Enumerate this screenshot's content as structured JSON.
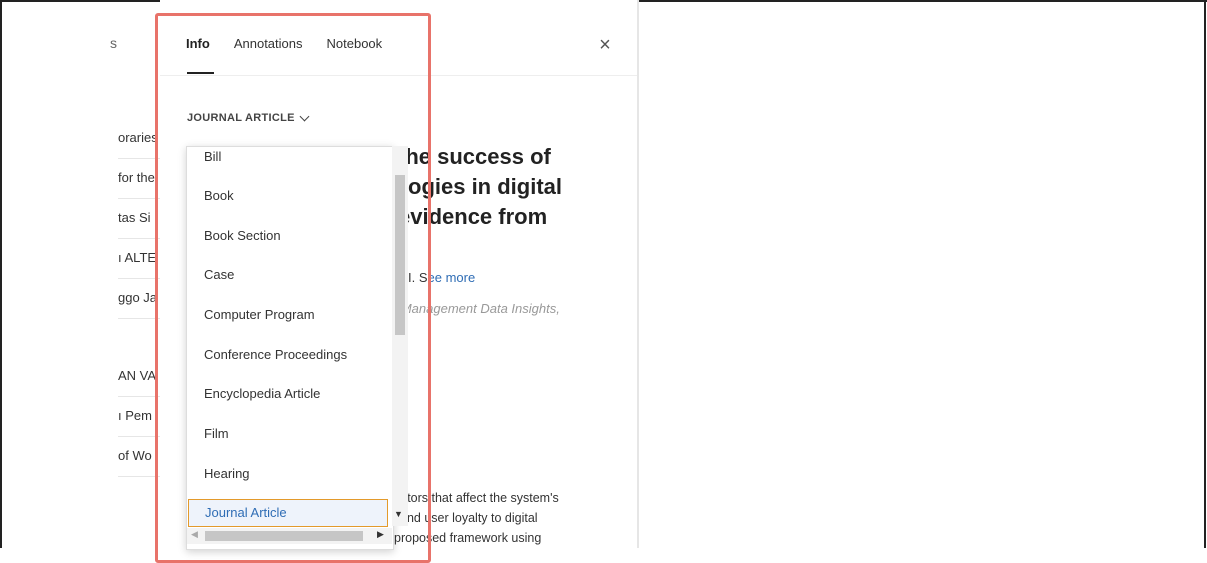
{
  "left_list": {
    "tab_fragment": "s",
    "items": [
      "oraries",
      "for the",
      "tas Si",
      "ı ALTE",
      "ggo Ja",
      "AN VA",
      "ı Pem",
      "of Wo"
    ]
  },
  "tabs": [
    {
      "label": "Info",
      "active": true
    },
    {
      "label": "Annotations",
      "active": false
    },
    {
      "label": "Notebook",
      "active": false
    }
  ],
  "close_symbol": "×",
  "item_type_selector": "JOURNAL ARTICLE",
  "title_lines": [
    "the success of",
    "ogies in digital",
    "evidence from"
  ],
  "authors": {
    "text": "I. S",
    "see_more": "ee more"
  },
  "source_text": "e Management Data Insights,",
  "abstract_lines": [
    "actors that affect the system's",
    "and user loyalty to digital",
    "proposed framework using"
  ],
  "dropdown": {
    "options": [
      "Bill",
      "Book",
      "Book Section",
      "Case",
      "Computer Program",
      "Conference Proceedings",
      "Encyclopedia Article",
      "Film",
      "Hearing",
      "Journal Article"
    ],
    "selected": "Journal Article"
  },
  "colors": {
    "accent": "#2f6db5",
    "highlight": "#e8736a",
    "selected_border": "#e39a2b"
  },
  "icons": {
    "close": "close-icon",
    "chevron": "chevron-down-icon"
  }
}
